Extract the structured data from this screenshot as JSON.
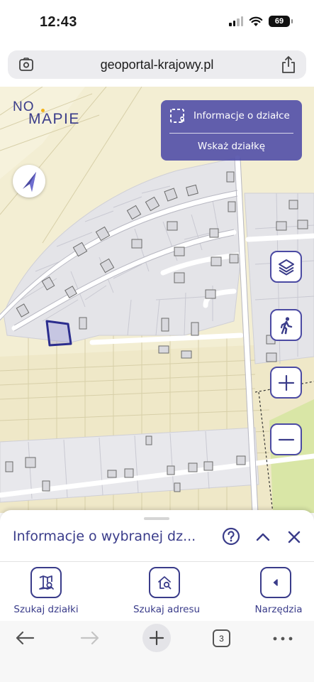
{
  "status_bar": {
    "time": "12:43",
    "battery": "69"
  },
  "browser": {
    "url": "geoportal-krajowy.pl",
    "tab_count": "3"
  },
  "app": {
    "logo_line1": "NO",
    "logo_line2": "MAPIE",
    "parcel_panel": {
      "info_label": "Informacje o działce",
      "show_label": "Wskaż działkę"
    }
  },
  "sheet": {
    "title": "Informacje o wybranej dz...",
    "tools": [
      {
        "label": "Szukaj działki",
        "icon": "map-search-icon"
      },
      {
        "label": "Szukaj adresu",
        "icon": "home-search-icon"
      },
      {
        "label": "Narzędzia",
        "icon": "chevron-left-icon"
      }
    ]
  },
  "colors": {
    "brand": "#3a3c8a",
    "panel": "#4c4aa6",
    "map_base": "#f3eed3",
    "parcel_fill": "#e4e4e8",
    "selected_parcel": "#2b2d8e"
  }
}
